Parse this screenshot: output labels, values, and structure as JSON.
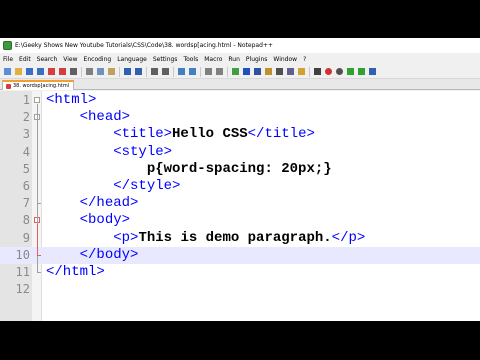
{
  "window": {
    "title": "E:\\Geeky Shows New Youtube Tutorials\\CSS\\Code\\38. wordsp[acing.html - Notepad++"
  },
  "menu": [
    "File",
    "Edit",
    "Search",
    "View",
    "Encoding",
    "Language",
    "Settings",
    "Tools",
    "Macro",
    "Run",
    "Plugins",
    "Window",
    "?"
  ],
  "tab": {
    "label": "38. wordsp[acing.html"
  },
  "editor": {
    "line_numbers": [
      "1",
      "2",
      "3",
      "4",
      "5",
      "6",
      "7",
      "8",
      "9",
      "10",
      "11",
      "12"
    ],
    "current_line": 10,
    "lines": [
      {
        "indent": "",
        "tag_open": "<html>",
        "text": "",
        "tag_close": ""
      },
      {
        "indent": "    ",
        "tag_open": "<head>",
        "text": "",
        "tag_close": ""
      },
      {
        "indent": "        ",
        "tag_open": "<title>",
        "text": "Hello CSS",
        "tag_close": "</title>"
      },
      {
        "indent": "        ",
        "tag_open": "<style>",
        "text": "",
        "tag_close": ""
      },
      {
        "indent": "            ",
        "tag_open": "",
        "text": "p{word-spacing: 20px;}",
        "tag_close": ""
      },
      {
        "indent": "        ",
        "tag_open": "</style>",
        "text": "",
        "tag_close": ""
      },
      {
        "indent": "    ",
        "tag_open": "</head>",
        "text": "",
        "tag_close": ""
      },
      {
        "indent": "    ",
        "tag_open": "<body>",
        "text": "",
        "tag_close": ""
      },
      {
        "indent": "        ",
        "tag_open": "<p>",
        "text": "This is demo paragraph.",
        "tag_close": "</p>"
      },
      {
        "indent": "    ",
        "tag_open": "</body>",
        "text": "",
        "tag_close": ""
      },
      {
        "indent": "",
        "tag_open": "</html>",
        "text": "",
        "tag_close": ""
      },
      {
        "indent": "",
        "tag_open": "",
        "text": "",
        "tag_close": ""
      }
    ]
  },
  "toolbar_icons": [
    "new-file-icon",
    "open-file-icon",
    "save-icon",
    "save-all-icon",
    "close-icon",
    "close-all-icon",
    "print-icon",
    "cut-icon",
    "copy-icon",
    "paste-icon",
    "undo-icon",
    "redo-icon",
    "find-icon",
    "replace-icon",
    "zoom-in-icon",
    "zoom-out-icon",
    "sync-v-icon",
    "sync-h-icon",
    "word-wrap-icon",
    "all-chars-icon",
    "indent-guide-icon",
    "user-lang-icon",
    "doc-map-icon",
    "function-list-icon",
    "folder-workspace-icon",
    "monitor-icon",
    "record-macro-icon",
    "stop-record-icon",
    "play-macro-icon",
    "play-multiple-icon",
    "save-macro-icon"
  ],
  "colors": {
    "tag": "#0000ff",
    "current_line": "#e8e8ff",
    "tab_accent": "#f0a030"
  }
}
